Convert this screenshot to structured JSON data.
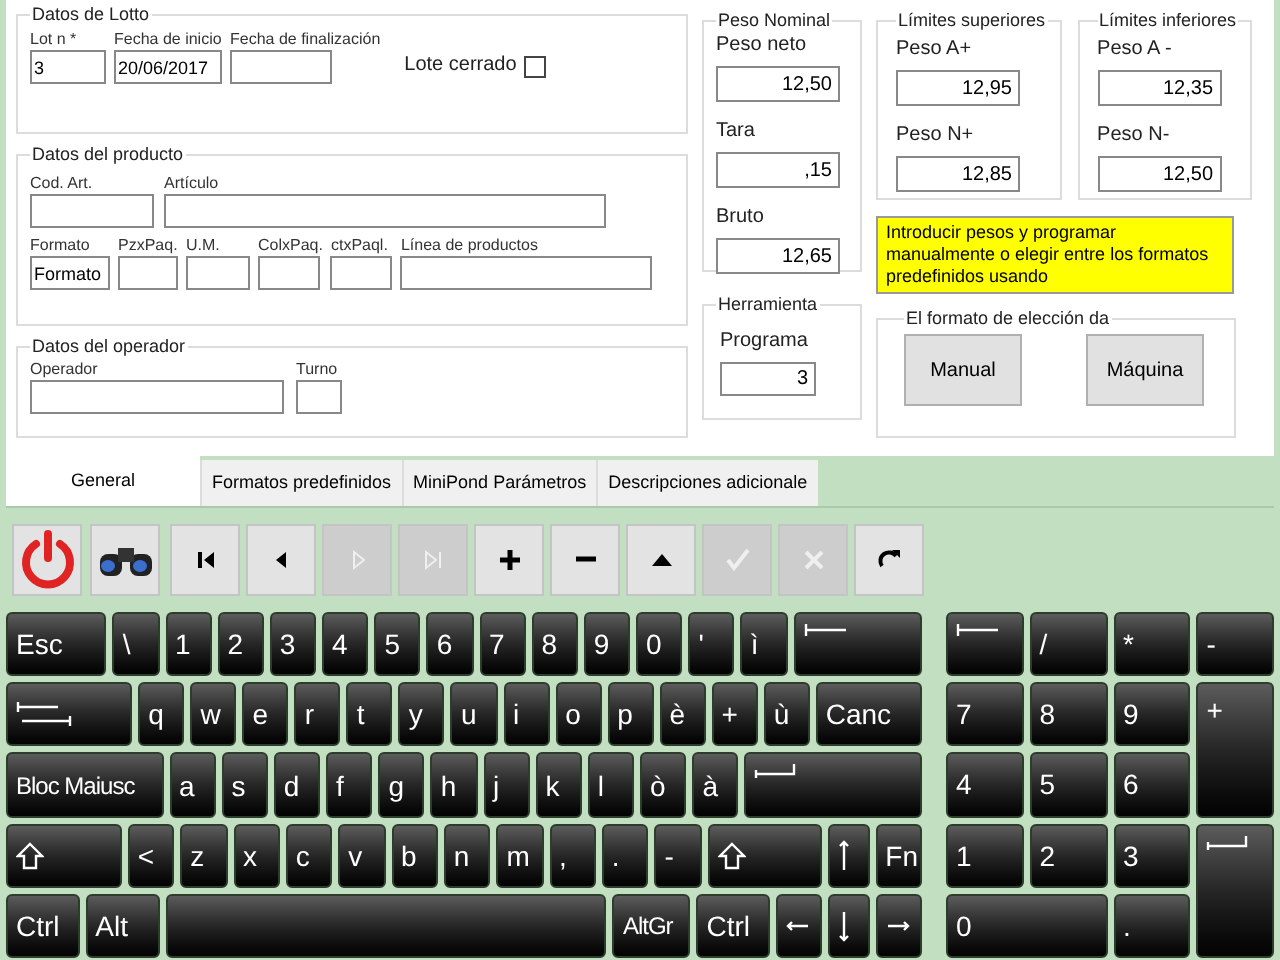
{
  "lot_data": {
    "title": "Datos de Lotto",
    "fields": [
      {
        "label": "Lot n *",
        "value": "3"
      },
      {
        "label": "Fecha de inicio",
        "value": "20/06/2017"
      },
      {
        "label": "Fecha de finalización"
      }
    ],
    "closed": {
      "label": "Lote cerrado",
      "checked": false
    }
  },
  "product_data": {
    "title": "Datos del producto",
    "row_1": [
      {
        "label": "Cod. Art."
      },
      {
        "label": "Artículo"
      }
    ],
    "row_2": [
      {
        "label": "Formato",
        "value": "Formato"
      },
      {
        "label": "PzxPaq."
      },
      {
        "label": "U.M."
      },
      {
        "label": "ColxPaq."
      },
      {
        "label": "ctxPaql."
      },
      {
        "label": "Línea de productos"
      }
    ]
  },
  "operator_data": {
    "title": "Datos del operador",
    "fields": [
      {
        "label": "Operador"
      },
      {
        "label": "Turno"
      }
    ]
  },
  "nominal_weight": {
    "title": "Peso Nominal",
    "fields": [
      {
        "label": "Peso neto",
        "value": "12,50"
      },
      {
        "label": "Tara",
        "value": ",15"
      },
      {
        "label": "Bruto",
        "value": "12,65"
      }
    ]
  },
  "upper_limits": {
    "title": "Límites superiores",
    "fields": [
      {
        "label": "Peso A+",
        "value": "12,95"
      },
      {
        "label": "Peso N+",
        "value": "12,85"
      }
    ]
  },
  "lower_limits": {
    "title": "Límites inferiores",
    "fields": [
      {
        "label": "Peso A -",
        "value": "12,35"
      },
      {
        "label": "Peso N-",
        "value": "12,50"
      }
    ]
  },
  "note": "Introducir pesos y programar manualmente o elegir entre los formatos predefinidos usando",
  "tool": {
    "title": "Herramienta",
    "fields": [
      {
        "label": "Programa",
        "value": "3"
      }
    ]
  },
  "format_choice": {
    "title": "El formato de elección da",
    "buttons": [
      "Manual",
      "Máquina"
    ]
  },
  "tabs": [
    {
      "label": "General",
      "selected": true
    },
    {
      "label": "Formatos predefinidos",
      "selected": false
    },
    {
      "label": "MiniPond Parámetros",
      "selected": false
    },
    {
      "label": "Descripciones adicionale",
      "selected": false
    }
  ],
  "toolbar": [
    {
      "kind": "power",
      "disabled": false
    },
    {
      "kind": "binoculars",
      "disabled": false
    },
    {
      "kind": "first",
      "disabled": false
    },
    {
      "kind": "prev",
      "disabled": false
    },
    {
      "kind": "next",
      "disabled": true
    },
    {
      "kind": "last",
      "disabled": true
    },
    {
      "kind": "add",
      "disabled": false
    },
    {
      "kind": "remove",
      "disabled": false
    },
    {
      "kind": "up",
      "disabled": false
    },
    {
      "kind": "confirm",
      "disabled": true
    },
    {
      "kind": "cancel",
      "disabled": true
    },
    {
      "kind": "refresh",
      "disabled": false
    }
  ],
  "keyboard": {
    "main": [
      [
        {
          "kind": "text",
          "label": "Esc"
        },
        {
          "kind": "text",
          "label": "\\"
        },
        {
          "kind": "text",
          "label": "1"
        },
        {
          "kind": "text",
          "label": "2"
        },
        {
          "kind": "text",
          "label": "3"
        },
        {
          "kind": "text",
          "label": "4"
        },
        {
          "kind": "text",
          "label": "5"
        },
        {
          "kind": "text",
          "label": "6"
        },
        {
          "kind": "text",
          "label": "7"
        },
        {
          "kind": "text",
          "label": "8"
        },
        {
          "kind": "text",
          "label": "9"
        },
        {
          "kind": "text",
          "label": "0"
        },
        {
          "kind": "text",
          "label": "'"
        },
        {
          "kind": "text",
          "label": "ì"
        },
        {
          "kind": "backspace"
        }
      ],
      [
        {
          "kind": "tab"
        },
        {
          "kind": "text",
          "label": "q"
        },
        {
          "kind": "text",
          "label": "w"
        },
        {
          "kind": "text",
          "label": "e"
        },
        {
          "kind": "text",
          "label": "r"
        },
        {
          "kind": "text",
          "label": "t"
        },
        {
          "kind": "text",
          "label": "y"
        },
        {
          "kind": "text",
          "label": "u"
        },
        {
          "kind": "text",
          "label": "i"
        },
        {
          "kind": "text",
          "label": "o"
        },
        {
          "kind": "text",
          "label": "p"
        },
        {
          "kind": "text",
          "label": "è"
        },
        {
          "kind": "text",
          "label": "+"
        },
        {
          "kind": "text",
          "label": "ù"
        },
        {
          "kind": "text",
          "label": "Canc"
        }
      ],
      [
        {
          "kind": "text",
          "label": "Bloc Maiusc"
        },
        {
          "kind": "text",
          "label": "a"
        },
        {
          "kind": "text",
          "label": "s"
        },
        {
          "kind": "text",
          "label": "d"
        },
        {
          "kind": "text",
          "label": "f"
        },
        {
          "kind": "text",
          "label": "g"
        },
        {
          "kind": "text",
          "label": "h"
        },
        {
          "kind": "text",
          "label": "j"
        },
        {
          "kind": "text",
          "label": "k"
        },
        {
          "kind": "text",
          "label": "l"
        },
        {
          "kind": "text",
          "label": "ò"
        },
        {
          "kind": "text",
          "label": "à"
        },
        {
          "kind": "enter"
        }
      ],
      [
        {
          "kind": "shift"
        },
        {
          "kind": "text",
          "label": "<"
        },
        {
          "kind": "text",
          "label": "z"
        },
        {
          "kind": "text",
          "label": "x"
        },
        {
          "kind": "text",
          "label": "c"
        },
        {
          "kind": "text",
          "label": "v"
        },
        {
          "kind": "text",
          "label": "b"
        },
        {
          "kind": "text",
          "label": "n"
        },
        {
          "kind": "text",
          "label": "m"
        },
        {
          "kind": "text",
          "label": ","
        },
        {
          "kind": "text",
          "label": "."
        },
        {
          "kind": "text",
          "label": "-"
        },
        {
          "kind": "shift"
        },
        {
          "kind": "up"
        },
        {
          "kind": "text",
          "label": "Fn"
        }
      ],
      [
        {
          "kind": "text",
          "label": "Ctrl"
        },
        {
          "kind": "text",
          "label": "Alt"
        },
        {
          "kind": "space"
        },
        {
          "kind": "text",
          "label": "AltGr"
        },
        {
          "kind": "text",
          "label": "Ctrl"
        },
        {
          "kind": "left"
        },
        {
          "kind": "down"
        },
        {
          "kind": "right"
        }
      ]
    ],
    "numpad": [
      {
        "kind": "backspace"
      },
      {
        "kind": "text",
        "label": "/"
      },
      {
        "kind": "text",
        "label": "*"
      },
      {
        "kind": "text",
        "label": "-"
      },
      {
        "kind": "text",
        "label": "7"
      },
      {
        "kind": "text",
        "label": "8"
      },
      {
        "kind": "text",
        "label": "9"
      },
      {
        "kind": "text",
        "label": "+"
      },
      {
        "kind": "text",
        "label": "4"
      },
      {
        "kind": "text",
        "label": "5"
      },
      {
        "kind": "text",
        "label": "6"
      },
      {
        "kind": "text",
        "label": "1"
      },
      {
        "kind": "text",
        "label": "2"
      },
      {
        "kind": "text",
        "label": "3"
      },
      {
        "kind": "enter"
      },
      {
        "kind": "text",
        "label": "0"
      },
      {
        "kind": "text",
        "label": "."
      }
    ]
  }
}
